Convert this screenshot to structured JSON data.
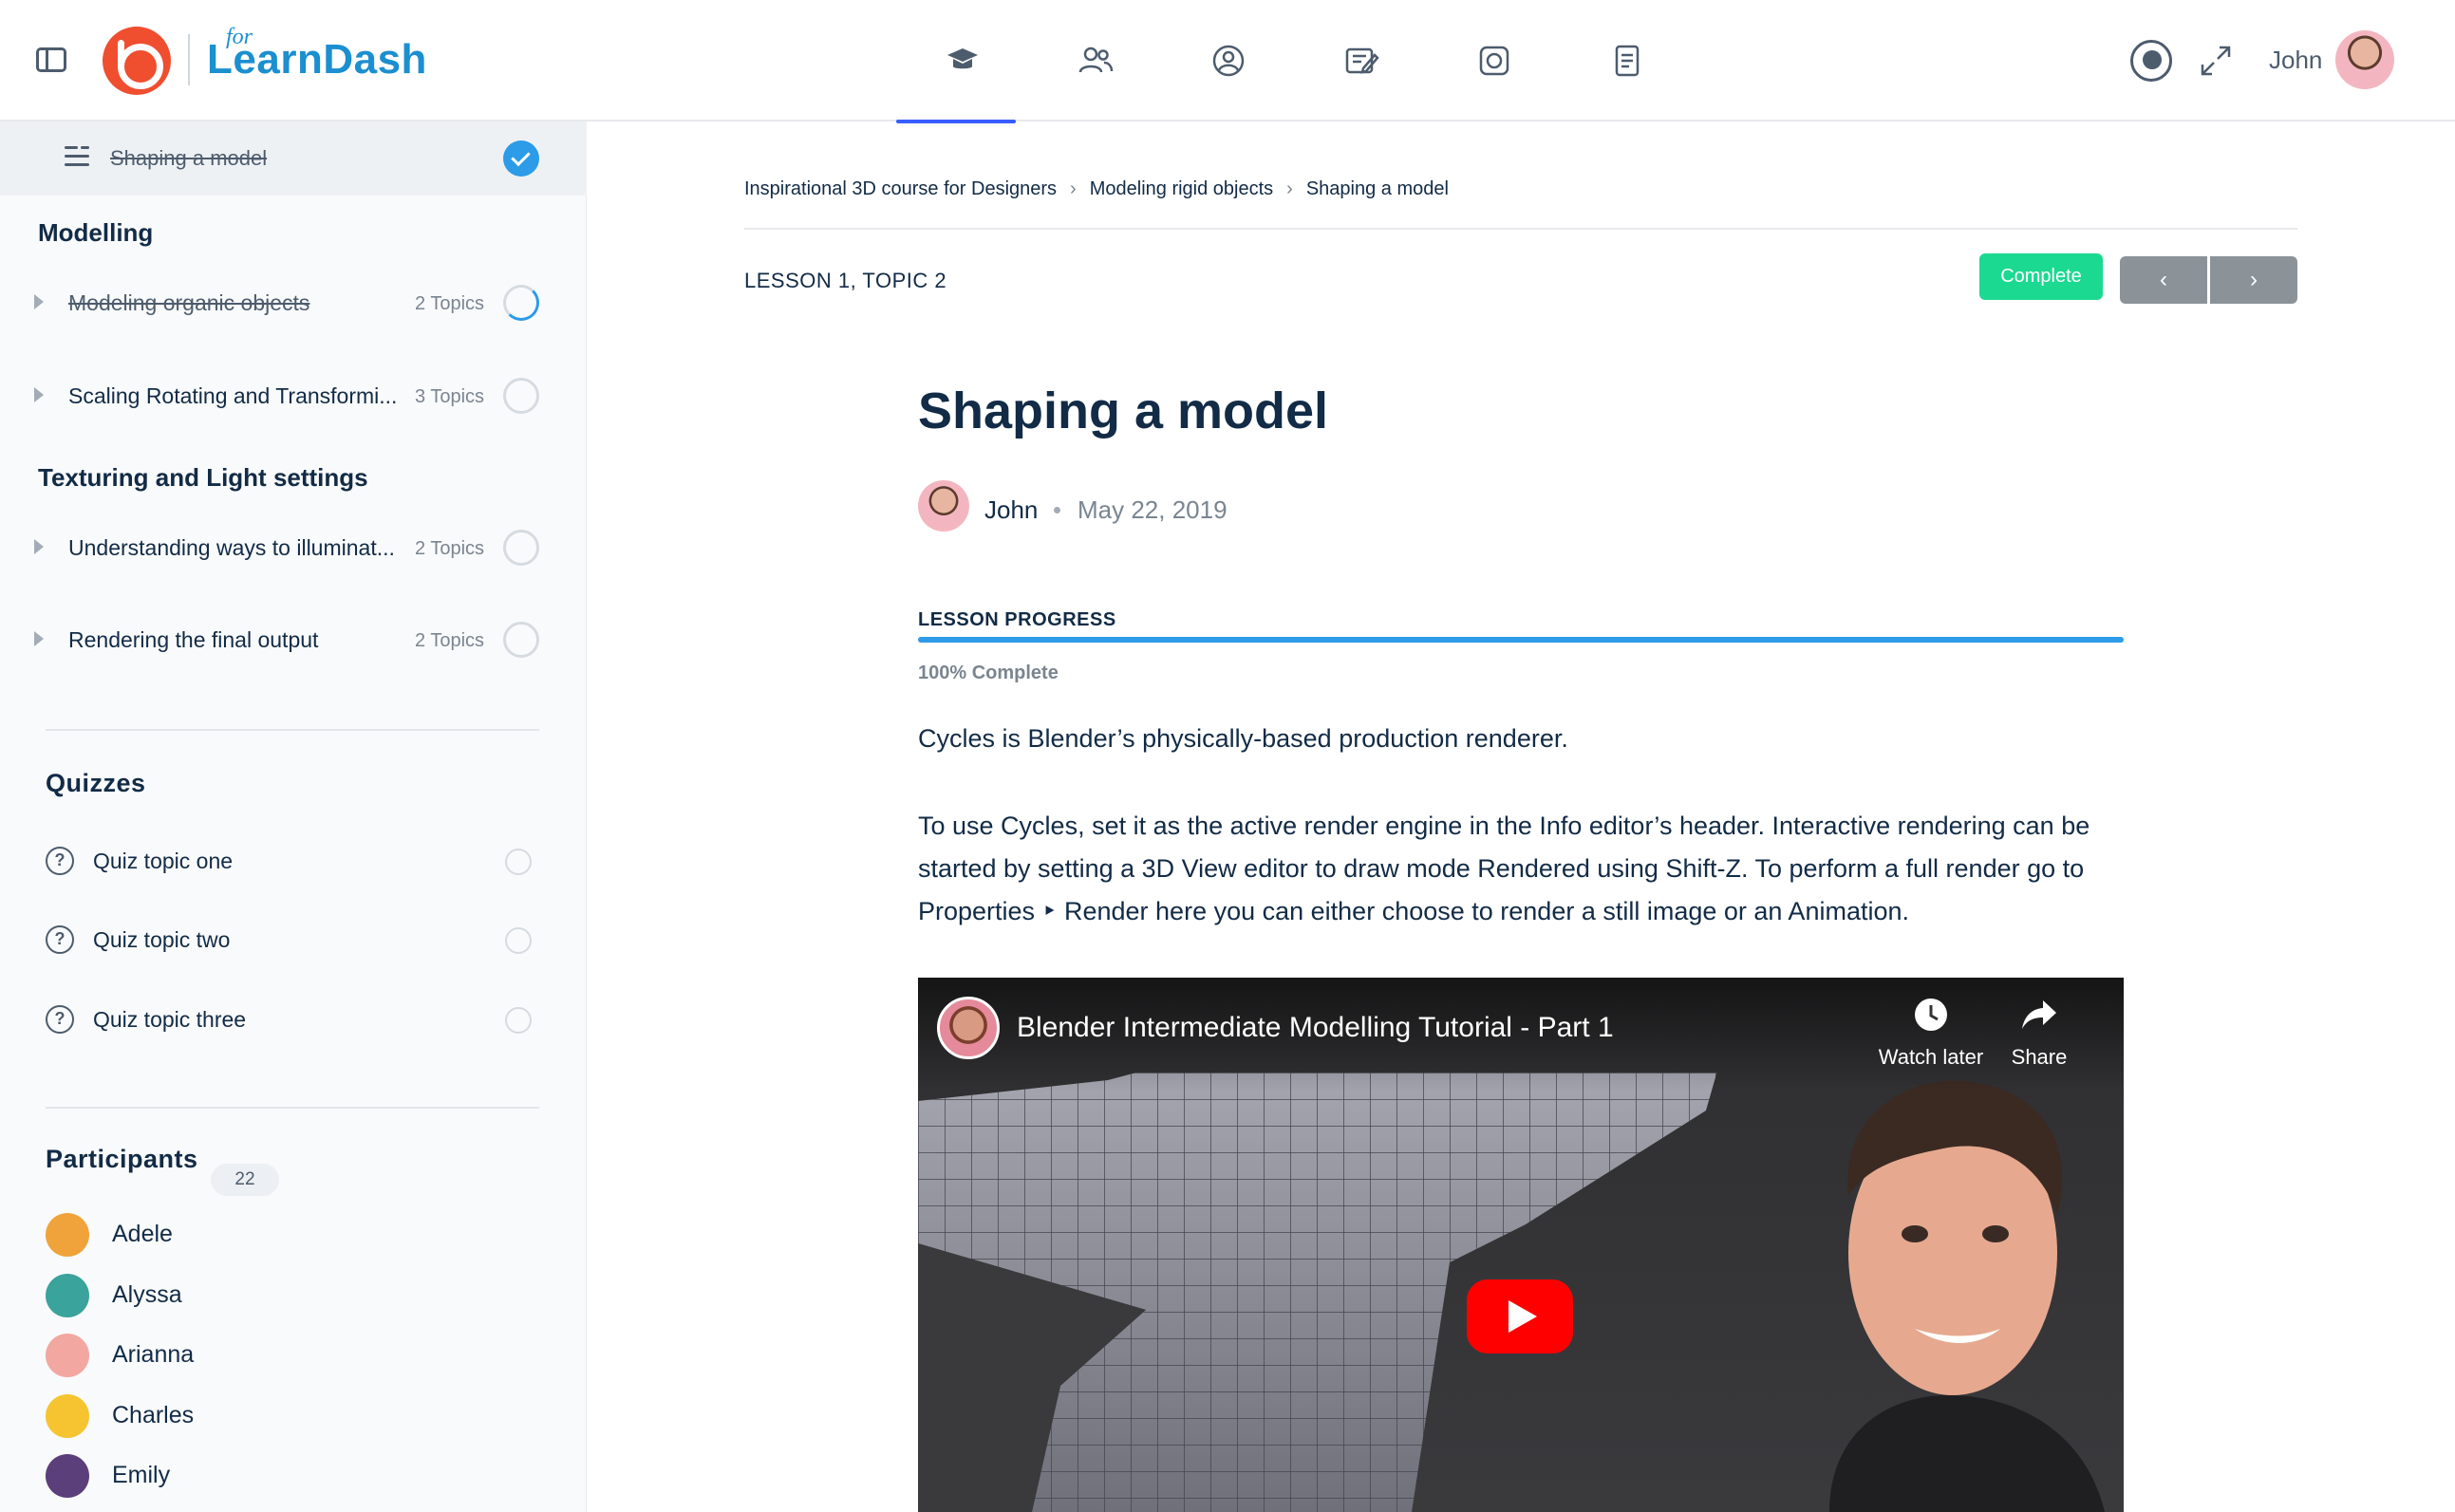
{
  "brand": {
    "for_text": "for",
    "name": "LearnDash",
    "accent_color": "#ef4e2f",
    "brand_color": "#1b8fd0"
  },
  "header": {
    "nav_icons": [
      "courses-icon",
      "members-icon",
      "profile-icon",
      "forums-icon",
      "photos-icon",
      "documents-icon"
    ],
    "active_nav_index": 0,
    "user_name": "John"
  },
  "sidebar": {
    "current_topic": "Shaping a model",
    "sections": [
      {
        "title": "Modelling",
        "lessons": [
          {
            "label": "Modeling organic objects",
            "count": "2 Topics",
            "status": "partial",
            "completed": true
          },
          {
            "label": "Scaling Rotating and Transformi...",
            "count": "3 Topics",
            "status": "empty",
            "completed": false
          }
        ]
      },
      {
        "title": "Texturing and Light settings",
        "lessons": [
          {
            "label": "Understanding ways to illuminat...",
            "count": "2 Topics",
            "status": "empty",
            "completed": false
          },
          {
            "label": "Rendering the final output",
            "count": "2 Topics",
            "status": "empty",
            "completed": false
          }
        ]
      }
    ],
    "quizzes_heading": "Quizzes",
    "quizzes": [
      "Quiz topic one",
      "Quiz topic two",
      "Quiz topic three"
    ],
    "participants_heading": "Participants",
    "participants_count": "22",
    "participants": [
      {
        "name": "Adele",
        "color": "#f0a33a"
      },
      {
        "name": "Alyssa",
        "color": "#3aa39b"
      },
      {
        "name": "Arianna",
        "color": "#f2a7a0"
      },
      {
        "name": "Charles",
        "color": "#f5c430"
      },
      {
        "name": "Emily",
        "color": "#5b3f7a"
      }
    ]
  },
  "main": {
    "breadcrumb": [
      "Inspirational 3D course for Designers",
      "Modeling rigid objects",
      "Shaping a model"
    ],
    "breadcrumb_separator": "›",
    "lesson_meta": "LESSON 1, TOPIC 2",
    "complete_label": "Complete",
    "prev_label": "‹",
    "next_label": "›",
    "title": "Shaping a model",
    "author": "John",
    "date": "May 22, 2019",
    "progress_label": "LESSON PROGRESS",
    "progress_percent": 100,
    "progress_text": "100% Complete",
    "paragraph_1": "Cycles is Blender’s physically-based production renderer.",
    "paragraph_2": "To use Cycles, set it as the active render engine in the Info editor’s header. Interactive rendering can be started by setting a 3D View editor to draw mode Rendered using Shift-Z. To perform a full render go to Properties ‣ Render here you can either choose to render a still image or an Animation.",
    "progress_color": "#2c9be8",
    "complete_color": "#1cd991"
  },
  "video": {
    "title": "Blender Intermediate Modelling Tutorial - Part 1",
    "watch_later": "Watch later",
    "share": "Share"
  }
}
